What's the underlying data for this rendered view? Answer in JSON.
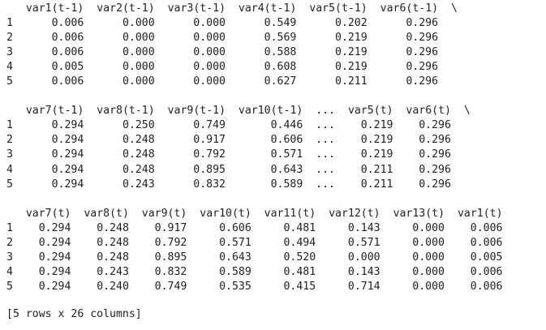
{
  "blocks": [
    {
      "columns": [
        "var1(t-1)",
        "var2(t-1)",
        "var3(t-1)",
        "var4(t-1)",
        "var5(t-1)",
        "var6(t-1)"
      ],
      "continued": true,
      "rows": [
        {
          "index": "1",
          "cells": [
            "0.006",
            "0.000",
            "0.000",
            "0.549",
            "0.202",
            "0.296"
          ]
        },
        {
          "index": "2",
          "cells": [
            "0.006",
            "0.000",
            "0.000",
            "0.569",
            "0.219",
            "0.296"
          ]
        },
        {
          "index": "3",
          "cells": [
            "0.006",
            "0.000",
            "0.000",
            "0.588",
            "0.219",
            "0.296"
          ]
        },
        {
          "index": "4",
          "cells": [
            "0.005",
            "0.000",
            "0.000",
            "0.608",
            "0.219",
            "0.296"
          ]
        },
        {
          "index": "5",
          "cells": [
            "0.006",
            "0.000",
            "0.000",
            "0.627",
            "0.211",
            "0.296"
          ]
        }
      ]
    },
    {
      "columns": [
        "var7(t-1)",
        "var8(t-1)",
        "var9(t-1)",
        "var10(t-1)",
        "...",
        "var5(t)",
        "var6(t)"
      ],
      "continued": true,
      "rows": [
        {
          "index": "1",
          "cells": [
            "0.294",
            "0.250",
            "0.749",
            "0.446",
            "...",
            "0.219",
            "0.296"
          ]
        },
        {
          "index": "2",
          "cells": [
            "0.294",
            "0.248",
            "0.917",
            "0.606",
            "...",
            "0.219",
            "0.296"
          ]
        },
        {
          "index": "3",
          "cells": [
            "0.294",
            "0.248",
            "0.792",
            "0.571",
            "...",
            "0.219",
            "0.296"
          ]
        },
        {
          "index": "4",
          "cells": [
            "0.294",
            "0.248",
            "0.895",
            "0.643",
            "...",
            "0.211",
            "0.296"
          ]
        },
        {
          "index": "5",
          "cells": [
            "0.294",
            "0.243",
            "0.832",
            "0.589",
            "...",
            "0.211",
            "0.296"
          ]
        }
      ]
    },
    {
      "columns": [
        "var7(t)",
        "var8(t)",
        "var9(t)",
        "var10(t)",
        "var11(t)",
        "var12(t)",
        "var13(t)",
        "var1(t)"
      ],
      "continued": false,
      "rows": [
        {
          "index": "1",
          "cells": [
            "0.294",
            "0.248",
            "0.917",
            "0.606",
            "0.481",
            "0.143",
            "0.000",
            "0.006"
          ]
        },
        {
          "index": "2",
          "cells": [
            "0.294",
            "0.248",
            "0.792",
            "0.571",
            "0.494",
            "0.571",
            "0.000",
            "0.006"
          ]
        },
        {
          "index": "3",
          "cells": [
            "0.294",
            "0.248",
            "0.895",
            "0.643",
            "0.520",
            "0.000",
            "0.000",
            "0.005"
          ]
        },
        {
          "index": "4",
          "cells": [
            "0.294",
            "0.243",
            "0.832",
            "0.589",
            "0.481",
            "0.143",
            "0.000",
            "0.006"
          ]
        },
        {
          "index": "5",
          "cells": [
            "0.294",
            "0.240",
            "0.749",
            "0.535",
            "0.415",
            "0.714",
            "0.000",
            "0.006"
          ]
        }
      ]
    }
  ],
  "continuation_mark": "\\",
  "footer": "[5 rows x 26 columns]"
}
